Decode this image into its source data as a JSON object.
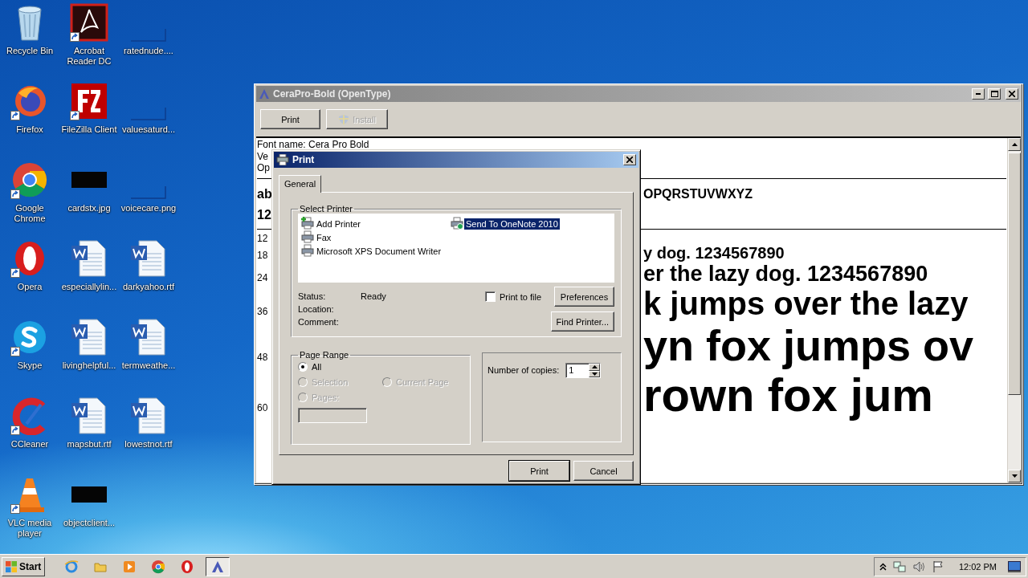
{
  "desktop_icons": [
    {
      "label": "Recycle Bin",
      "kind": "recycle",
      "shortcut": false
    },
    {
      "label": "Firefox",
      "kind": "firefox",
      "shortcut": true
    },
    {
      "label": "Google Chrome",
      "kind": "chrome",
      "shortcut": true
    },
    {
      "label": "Opera",
      "kind": "opera",
      "shortcut": true
    },
    {
      "label": "Skype",
      "kind": "skype",
      "shortcut": true
    },
    {
      "label": "CCleaner",
      "kind": "ccleaner",
      "shortcut": true
    },
    {
      "label": "VLC media player",
      "kind": "vlc",
      "shortcut": true
    },
    {
      "label": "Acrobat Reader DC",
      "kind": "acrobat",
      "shortcut": true
    },
    {
      "label": "FileZilla Client",
      "kind": "filezilla",
      "shortcut": true
    },
    {
      "label": "cardstx.jpg",
      "kind": "dark-thumb",
      "shortcut": false
    },
    {
      "label": "especiallylin...",
      "kind": "word",
      "shortcut": false
    },
    {
      "label": "livinghelpful...",
      "kind": "word",
      "shortcut": false
    },
    {
      "label": "mapsbut.rtf",
      "kind": "word",
      "shortcut": false
    },
    {
      "label": "objectclient...",
      "kind": "dark-thumb",
      "shortcut": false
    },
    {
      "label": "ratednude....",
      "kind": "blank-thumb",
      "shortcut": false
    },
    {
      "label": "valuesaturd...",
      "kind": "blank-thumb",
      "shortcut": false
    },
    {
      "label": "voicecare.png",
      "kind": "blank-thumb",
      "shortcut": false
    },
    {
      "label": "darkyahoo.rtf",
      "kind": "word",
      "shortcut": false
    },
    {
      "label": "termweathe...",
      "kind": "word",
      "shortcut": false
    },
    {
      "label": "lowestnot.rtf",
      "kind": "word",
      "shortcut": false
    }
  ],
  "font_window": {
    "title": "CeraPro-Bold (OpenType)",
    "toolbar": [
      {
        "label": "Print",
        "kind": "plain",
        "disabled": false
      },
      {
        "label": "Install",
        "kind": "shield",
        "disabled": true
      }
    ],
    "info": [
      "Font name: Cera Pro Bold",
      "Ve",
      "Op"
    ],
    "charset": {
      "letters_left": "ab",
      "letters_right": "OPQRSTUVWXYZ",
      "digits": "12"
    },
    "samples": [
      {
        "size": "12"
      },
      {
        "size": "18",
        "text": "y dog. 1234567890"
      },
      {
        "size": "24",
        "text": "er the lazy dog. 1234567890"
      },
      {
        "size": "36",
        "text": "k jumps over the lazy"
      },
      {
        "size": "48",
        "text": "yn fox jumps ov"
      },
      {
        "size": "60",
        "text": "rown fox jum"
      }
    ]
  },
  "print_dialog": {
    "title": "Print",
    "tabs": [
      {
        "label": "General",
        "selected": true
      }
    ],
    "printer_group": "Select Printer",
    "printers": [
      {
        "label": "Add Printer",
        "kind": "add",
        "selected": false
      },
      {
        "label": "Fax",
        "kind": "fax",
        "selected": false
      },
      {
        "label": "Microsoft XPS Document Writer",
        "kind": "printer",
        "selected": false
      },
      {
        "label": "Send To OneNote 2010",
        "kind": "onenote",
        "selected": true
      }
    ],
    "details": [
      {
        "label": "Status:",
        "value": "Ready"
      },
      {
        "label": "Location:"
      },
      {
        "label": "Comment:"
      }
    ],
    "print_to_file": {
      "label": "Print to file",
      "checked": false
    },
    "side_buttons": [
      "Preferences",
      "Find Printer..."
    ],
    "page_range": {
      "title": "Page Range",
      "options": [
        {
          "label": "All",
          "selected": true,
          "disabled": false
        },
        {
          "label": "Selection",
          "selected": false,
          "disabled": true
        },
        {
          "label": "Current Page",
          "selected": false,
          "disabled": true
        },
        {
          "label": "Pages:",
          "selected": false,
          "disabled": true
        }
      ]
    },
    "pages_field": {
      "disabled": true
    },
    "copies": {
      "label": "Number of copies:",
      "value": "1"
    },
    "buttons": [
      {
        "label": "Print",
        "default": true
      },
      {
        "label": "Cancel",
        "default": false
      }
    ]
  },
  "taskbar": {
    "start": "Start",
    "apps": [
      {
        "kind": "ie",
        "active": false
      },
      {
        "kind": "folder",
        "active": false
      },
      {
        "kind": "media",
        "active": false
      },
      {
        "kind": "chrome",
        "active": false
      },
      {
        "kind": "opera",
        "active": false
      },
      {
        "kind": "font",
        "active": true
      }
    ],
    "clock": "12:02 PM"
  }
}
